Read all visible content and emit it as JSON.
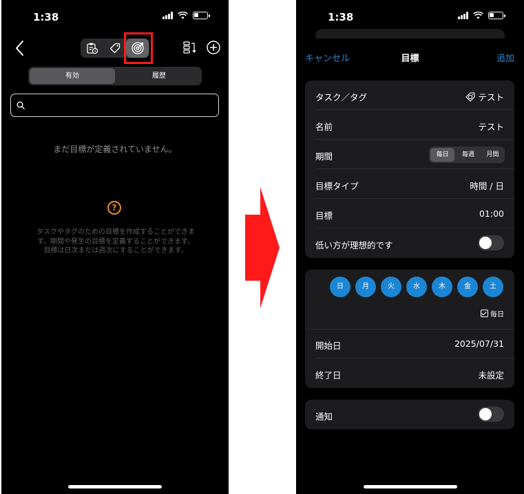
{
  "left": {
    "status": {
      "time": "1:38"
    },
    "nav": {
      "icons": [
        "clipboard-clock-icon",
        "tag-icon",
        "target-icon"
      ],
      "selected_icon": "target-icon",
      "right_icons": [
        "list-sort-icon",
        "plus-circle-icon"
      ]
    },
    "tabs": [
      {
        "label": "有効",
        "selected": true
      },
      {
        "label": "履歴",
        "selected": false
      }
    ],
    "search": {
      "placeholder": ""
    },
    "empty_message": "まだ目標が定義されていません。",
    "description": "タスクやタグのための目標を作成することができます。期間や発生の目標を定義することができます。目標は日次または週次にすることができます。"
  },
  "right": {
    "status": {
      "time": "1:38"
    },
    "header": {
      "cancel": "キャンセル",
      "title": "目標",
      "add": "追加"
    },
    "rows": {
      "task_tag": {
        "label": "タスク／タグ",
        "value": "テスト"
      },
      "name": {
        "label": "名前",
        "value": "テスト"
      },
      "period": {
        "label": "期間",
        "options": [
          "毎日",
          "毎週",
          "月間"
        ],
        "selected": "毎日"
      },
      "goal_type": {
        "label": "目標タイプ",
        "value": "時間 / 日"
      },
      "goal": {
        "label": "目標",
        "value": "01:00"
      },
      "lower_is_ideal": {
        "label": "低い方が理想的です",
        "on": false
      }
    },
    "days": [
      "日",
      "月",
      "火",
      "水",
      "木",
      "金",
      "土"
    ],
    "everyday_label": "毎日",
    "start_date": {
      "label": "開始日",
      "value": "2025/07/31"
    },
    "end_date": {
      "label": "終了日",
      "value": "未設定"
    },
    "notification": {
      "label": "通知",
      "on": false
    }
  },
  "colors": {
    "accent": "#2d8ad8",
    "day_circle": "#1d86d4",
    "help_icon": "#f08a24",
    "highlight_box": "#ff1a1a",
    "arrow": "#ff1a1a"
  }
}
